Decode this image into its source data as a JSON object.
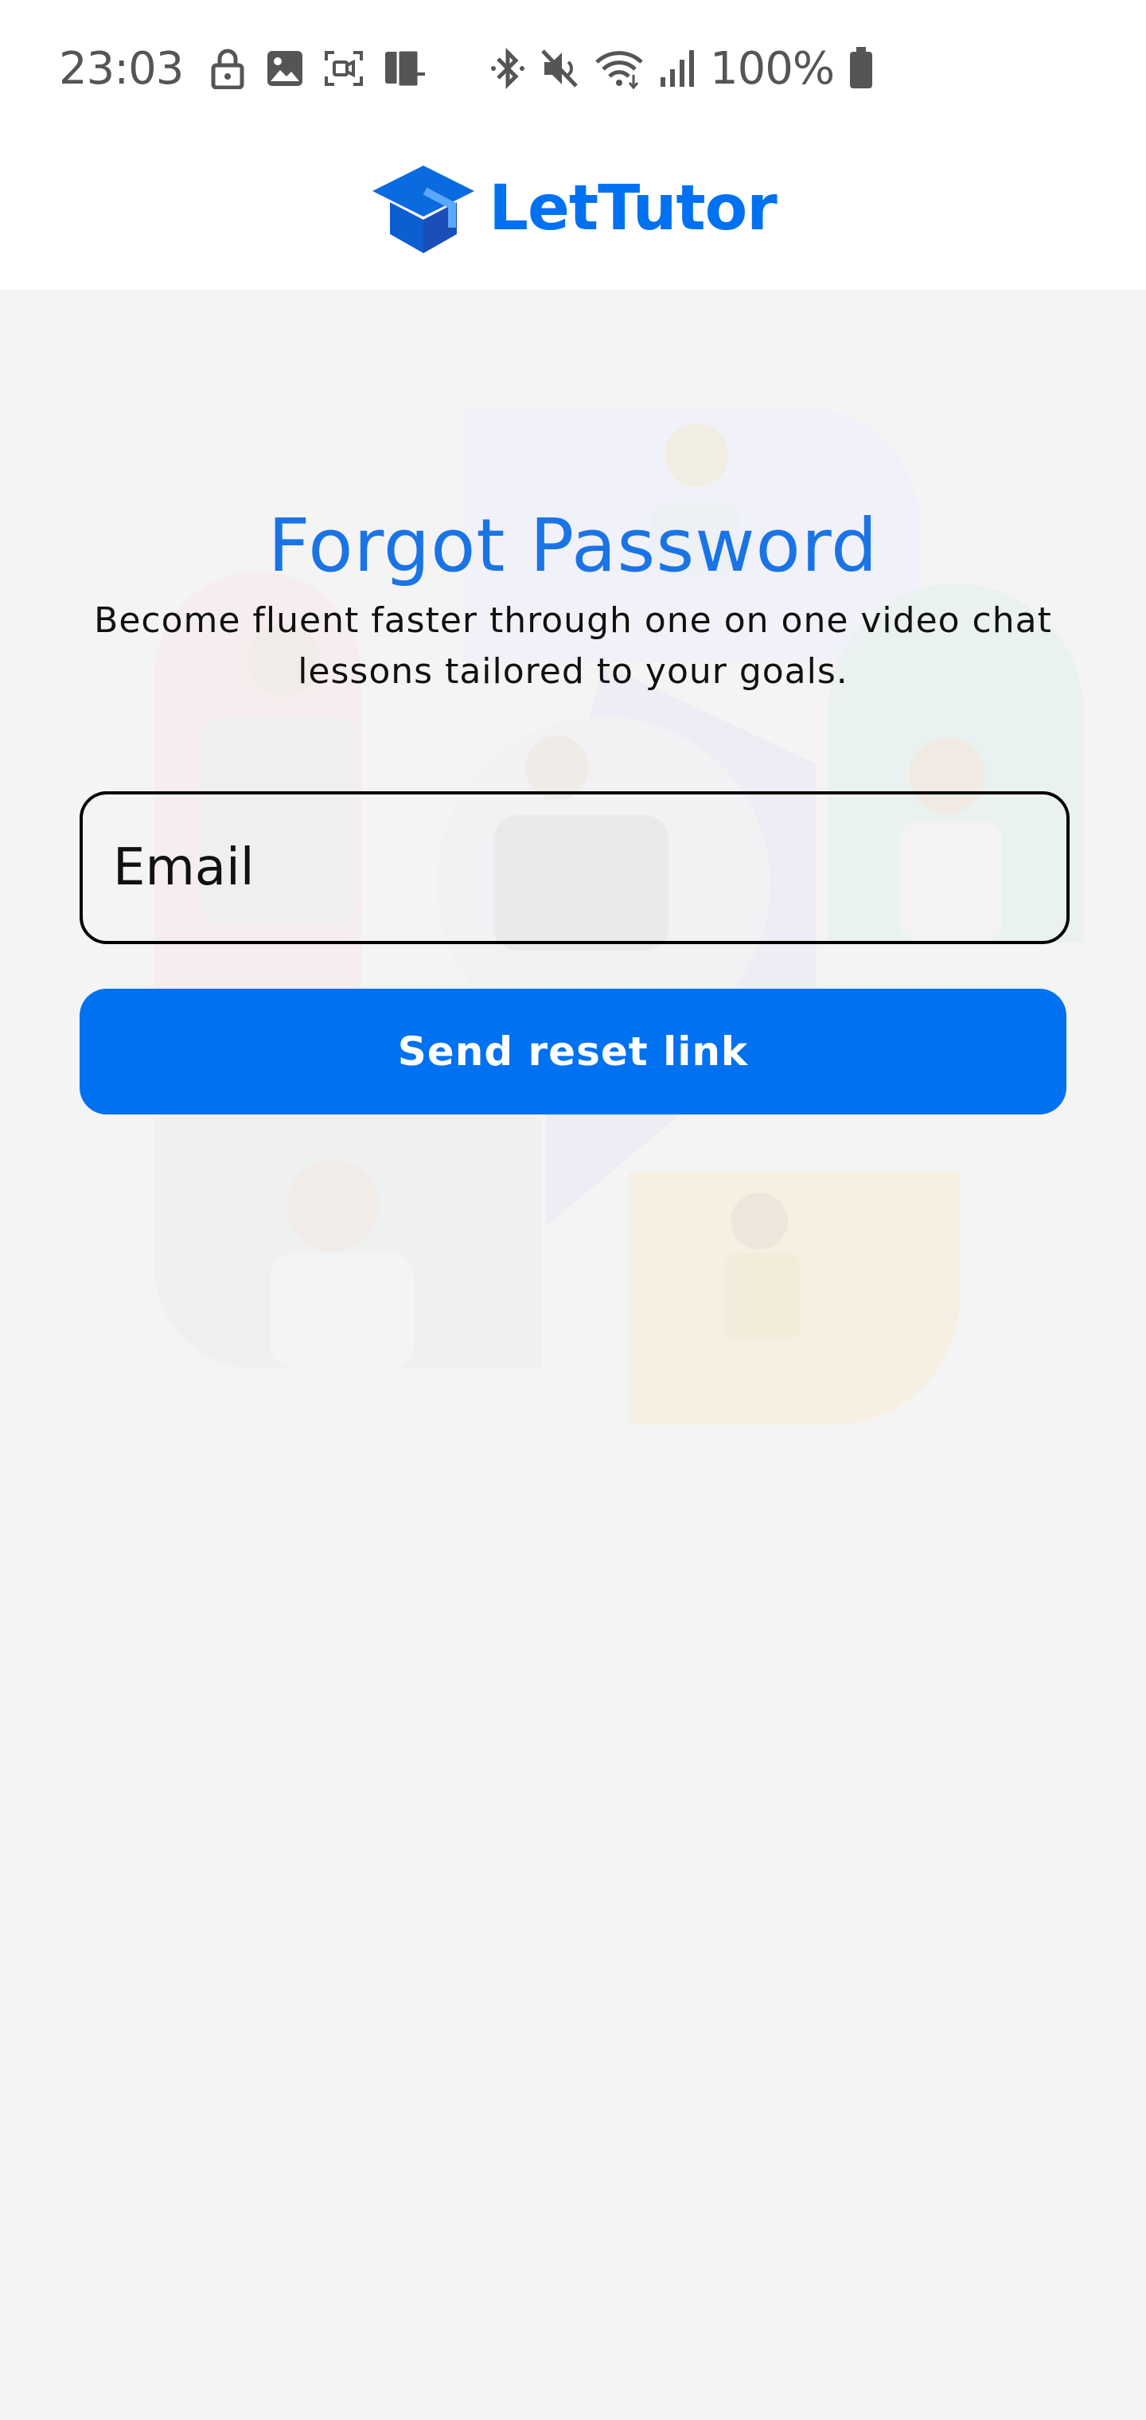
{
  "status_bar": {
    "time": "23:03",
    "battery_percent": "100%",
    "icons_left": [
      "lock-icon",
      "image-icon",
      "screen-record-icon",
      "device-icon"
    ],
    "icons_right": [
      "bluetooth-icon",
      "mute-icon",
      "wifi-icon",
      "signal-icon",
      "battery-icon"
    ]
  },
  "header": {
    "brand_name": "LetTutor",
    "logo_icon": "graduation-cap-icon"
  },
  "main": {
    "title": "Forgot Password",
    "subtitle": "Become fluent faster through one on one video chat lessons tailored to your goals.",
    "email_placeholder": "Email",
    "email_value": "",
    "submit_label": "Send reset link"
  },
  "colors": {
    "brand": "#0071f0",
    "title": "#1a74e5",
    "background": "#f4f4f4",
    "header": "#ffffff"
  }
}
